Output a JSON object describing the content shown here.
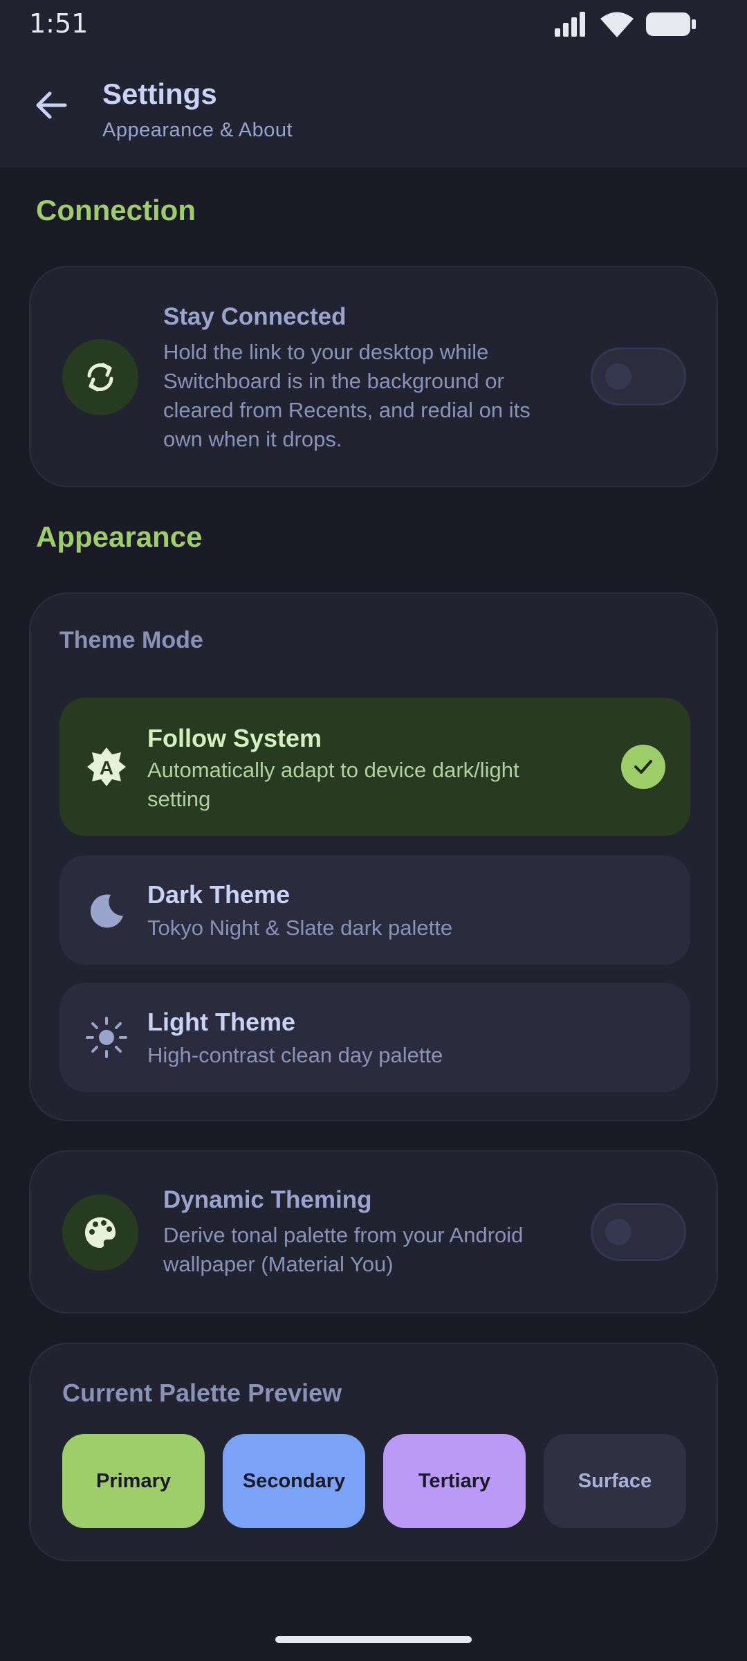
{
  "status_bar": {
    "time": "1:51"
  },
  "app_bar": {
    "title": "Settings",
    "subtitle": "Appearance & About"
  },
  "connection": {
    "header": "Connection",
    "stay_connected": {
      "title": "Stay Connected",
      "desc_lines": [
        "Hold the link to your desktop while",
        "Switchboard is in the background or",
        "cleared from Recents, and redial on its",
        "own when it drops."
      ],
      "enabled": false
    }
  },
  "appearance": {
    "header": "Appearance",
    "theme_mode_label": "Theme Mode",
    "options": [
      {
        "title": "Follow System",
        "desc_lines": [
          "Automatically adapt to device dark/light",
          "setting"
        ],
        "selected": true
      },
      {
        "title": "Dark Theme",
        "desc_lines": [
          "Tokyo Night & Slate dark palette"
        ],
        "selected": false
      },
      {
        "title": "Light Theme",
        "desc_lines": [
          "High-contrast clean day palette"
        ],
        "selected": false
      }
    ],
    "dynamic_theming": {
      "title": "Dynamic Theming",
      "desc_lines": [
        "Derive tonal palette from your Android",
        "wallpaper (Material You)"
      ],
      "enabled": false
    },
    "palette_preview": {
      "title": "Current Palette Preview",
      "swatches": [
        {
          "label": "Primary",
          "color": "#9ece6a"
        },
        {
          "label": "Secondary",
          "color": "#7aa2f7"
        },
        {
          "label": "Tertiary",
          "color": "#bb9af7"
        },
        {
          "label": "Surface",
          "color": "#2f3143"
        }
      ]
    }
  }
}
